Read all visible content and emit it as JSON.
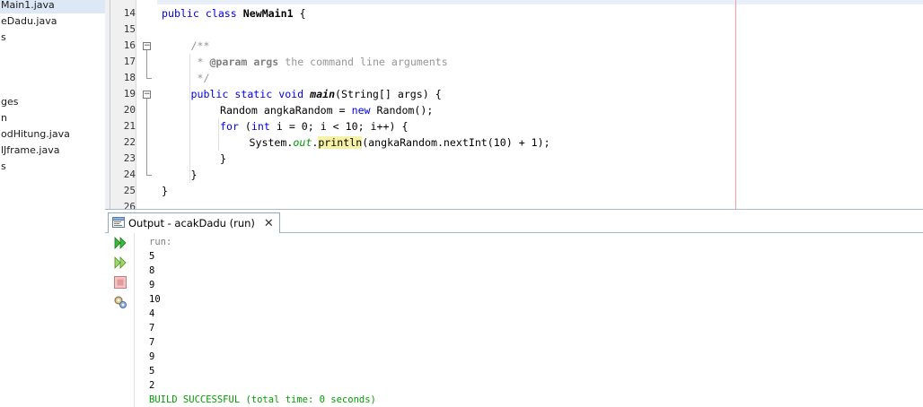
{
  "project_tree": {
    "items": [
      {
        "label": "Main1.java",
        "selected": true
      },
      {
        "label": "eDadu.java"
      },
      {
        "label": "s"
      },
      {
        "label": ""
      },
      {
        "label": ""
      },
      {
        "label": ""
      },
      {
        "label": "ges"
      },
      {
        "label": "n"
      },
      {
        "label": "odHitung.java"
      },
      {
        "label": "lJframe.java"
      },
      {
        "label": "s"
      },
      {
        "label": ""
      },
      {
        "label": ""
      }
    ]
  },
  "editor": {
    "top_partial_line": "",
    "lines": [
      {
        "num": "14",
        "kind": "class_decl",
        "kw": "public class ",
        "name": "NewMain1",
        "rest": " {"
      },
      {
        "num": "15",
        "kind": "blank"
      },
      {
        "num": "16",
        "kind": "comment",
        "text": "/**"
      },
      {
        "num": "17",
        "kind": "param",
        "prefix": " * ",
        "tag": "@param",
        "name": " args",
        "desc": " the command line arguments"
      },
      {
        "num": "18",
        "kind": "comment",
        "text": " */"
      },
      {
        "num": "19",
        "kind": "method",
        "kw": "public static void ",
        "name": "main",
        "rest": "(String[] args) {"
      },
      {
        "num": "20",
        "kind": "stmt_new",
        "pre": "Random angkaRandom = ",
        "kw": "new",
        "post": " Random();"
      },
      {
        "num": "21",
        "kind": "for",
        "kw1": "for",
        "mid1": " (",
        "kw2": "int",
        "mid2": " i = 0; i < 10; i++) {"
      },
      {
        "num": "22",
        "kind": "println",
        "pre": "System.",
        "field": "out",
        "dot": ".",
        "method": "println",
        "post": "(angkaRandom.nextInt(10) + 1);"
      },
      {
        "num": "23",
        "kind": "close",
        "text": "}"
      },
      {
        "num": "24",
        "kind": "close",
        "text": "}"
      },
      {
        "num": "25",
        "kind": "close",
        "text": "}"
      },
      {
        "num": "26",
        "kind": "blank"
      }
    ]
  },
  "output_panel": {
    "tab_title": "Output - acakDadu (run)",
    "close_glyph": "✕",
    "console": {
      "run_label": "run:",
      "values": [
        "5",
        "8",
        "9",
        "10",
        "4",
        "7",
        "7",
        "9",
        "5",
        "2"
      ],
      "build_status": "BUILD SUCCESSFUL (total time: 0 seconds)"
    }
  },
  "icons": {
    "rerun": "rerun-icon",
    "rerun_with_options": "rerun-options-icon",
    "stop": "stop-icon",
    "settings": "run-settings-icon",
    "output_tab": "output-window-icon"
  },
  "colors": {
    "keyword": "#0000e6",
    "comment": "#969696",
    "field": "#009900",
    "highlight": "#f6f2a5",
    "build_success": "#00a000",
    "margin_line": "#ff9a9a"
  }
}
